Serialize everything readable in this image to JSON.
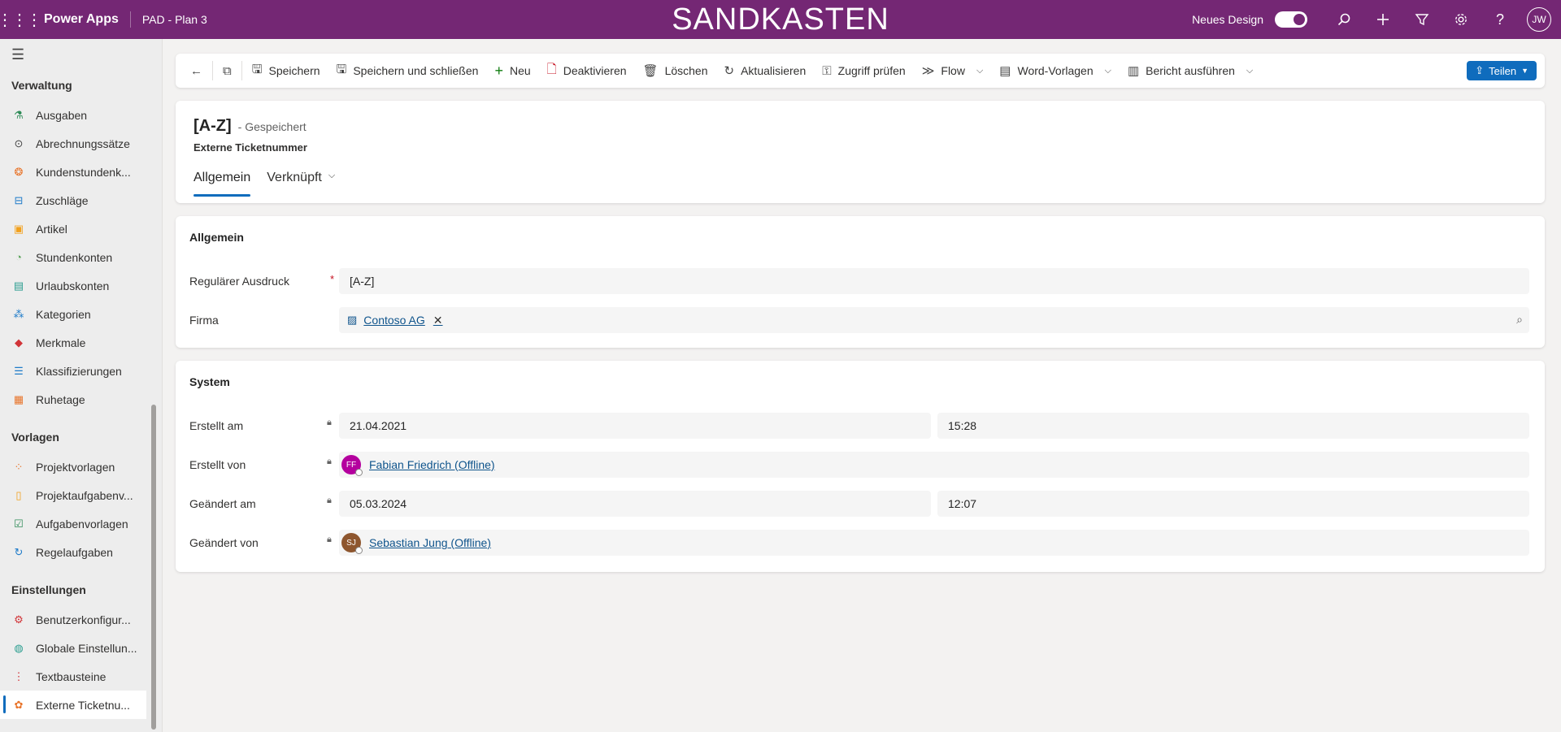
{
  "topbar": {
    "app_name": "Power Apps",
    "env_name": "PAD - Plan 3",
    "banner": "SANDKASTEN",
    "new_design_label": "Neues Design",
    "user_initials": "JW"
  },
  "sidebar": {
    "groups": [
      {
        "title": "Verwaltung",
        "items": [
          {
            "label": "Ausgaben",
            "icon": "expense-icon"
          },
          {
            "label": "Abrechnungssätze",
            "icon": "billing-rate-icon"
          },
          {
            "label": "Kundenstundenk...",
            "icon": "customer-hours-icon"
          },
          {
            "label": "Zuschläge",
            "icon": "surcharge-icon"
          },
          {
            "label": "Artikel",
            "icon": "article-icon"
          },
          {
            "label": "Stundenkonten",
            "icon": "hour-account-icon"
          },
          {
            "label": "Urlaubskonten",
            "icon": "vacation-account-icon"
          },
          {
            "label": "Kategorien",
            "icon": "category-icon"
          },
          {
            "label": "Merkmale",
            "icon": "feature-icon"
          },
          {
            "label": "Klassifizierungen",
            "icon": "classification-icon"
          },
          {
            "label": "Ruhetage",
            "icon": "rest-day-icon"
          }
        ]
      },
      {
        "title": "Vorlagen",
        "items": [
          {
            "label": "Projektvorlagen",
            "icon": "project-template-icon"
          },
          {
            "label": "Projektaufgabenv...",
            "icon": "project-task-template-icon"
          },
          {
            "label": "Aufgabenvorlagen",
            "icon": "task-template-icon"
          },
          {
            "label": "Regelaufgaben",
            "icon": "recurring-task-icon"
          }
        ]
      },
      {
        "title": "Einstellungen",
        "items": [
          {
            "label": "Benutzerkonfigur...",
            "icon": "user-config-icon"
          },
          {
            "label": "Globale Einstellun...",
            "icon": "global-settings-icon"
          },
          {
            "label": "Textbausteine",
            "icon": "text-block-icon"
          },
          {
            "label": "Externe Ticketnu...",
            "icon": "external-ticket-icon"
          }
        ]
      }
    ]
  },
  "commandbar": {
    "save": "Speichern",
    "save_close": "Speichern und schließen",
    "new": "Neu",
    "deactivate": "Deaktivieren",
    "delete": "Löschen",
    "refresh": "Aktualisieren",
    "check_access": "Zugriff prüfen",
    "flow": "Flow",
    "word_templates": "Word-Vorlagen",
    "run_report": "Bericht ausführen",
    "share": "Teilen"
  },
  "record": {
    "name": "[A-Z]",
    "status": "- Gespeichert",
    "entity": "Externe Ticketnummer",
    "tabs": {
      "general": "Allgemein",
      "related": "Verknüpft"
    }
  },
  "section_general": {
    "title": "Allgemein",
    "regex_label": "Regulärer Ausdruck",
    "regex_required": "*",
    "regex_value": "[A-Z]",
    "company_label": "Firma",
    "company_value": "Contoso AG"
  },
  "section_system": {
    "title": "System",
    "created_on_label": "Erstellt am",
    "created_on_date": "21.04.2021",
    "created_on_time": "15:28",
    "created_by_label": "Erstellt von",
    "created_by_initials": "FF",
    "created_by_name": "Fabian Friedrich (Offline)",
    "modified_on_label": "Geändert am",
    "modified_on_date": "05.03.2024",
    "modified_on_time": "12:07",
    "modified_by_label": "Geändert von",
    "modified_by_initials": "SJ",
    "modified_by_name": "Sebastian Jung (Offline)"
  },
  "colors": {
    "topbar": "#742774",
    "accent": "#0f6cbd",
    "avatar_ff": "#b4009e",
    "avatar_sj": "#8e562e"
  }
}
